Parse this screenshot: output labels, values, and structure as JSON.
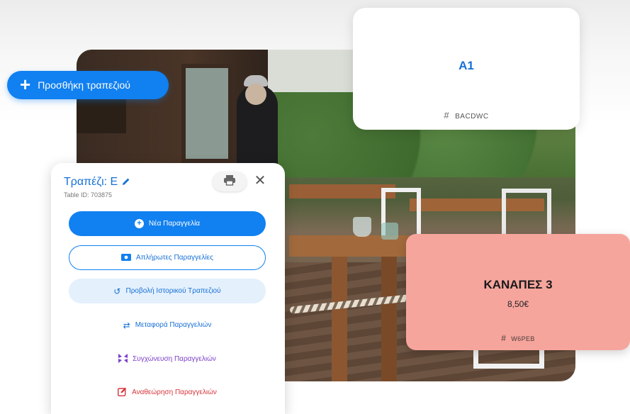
{
  "add_table": {
    "icon": "plus-icon",
    "label": "Προσθήκη τραπεζιού"
  },
  "card_a1": {
    "name": "A1",
    "code_icon": "hash-icon",
    "code": "BACDWC"
  },
  "card_kanapes": {
    "name": "ΚΑΝΑΠΕΣ 3",
    "price": "8,50€",
    "code_icon": "hash-icon",
    "code": "W6PEB",
    "background": "#f6a59d"
  },
  "panel": {
    "title": "Τραπέζι: Ε",
    "title_icon": "pencil-icon",
    "table_id": "Table ID: 703875",
    "print_icon": "printer-icon",
    "close_icon": "close-icon",
    "close_glyph": "✕",
    "buttons": {
      "new_order": {
        "label": "Νέα Παραγγελία",
        "icon": "plus-circle-icon",
        "glyph": "+"
      },
      "unpaid": {
        "label": "Απλήρωτες Παραγγελίες",
        "icon": "cash-icon"
      },
      "history": {
        "label": "Προβολή Ιστορικού Τραπεζιού",
        "icon": "history-icon",
        "glyph": "↺"
      },
      "transfer": {
        "label": "Μεταφορά Παραγγελιών",
        "icon": "swap-icon",
        "glyph": "⇄"
      },
      "merge": {
        "label": "Συγχώνευση Παραγγελιών",
        "icon": "merge-icon"
      },
      "review": {
        "label": "Αναθεώρηση Παραγγελιών",
        "icon": "edit-icon"
      }
    }
  },
  "colors": {
    "primary": "#1180f0",
    "merge": "#7b3fc9",
    "review": "#d8343a"
  }
}
